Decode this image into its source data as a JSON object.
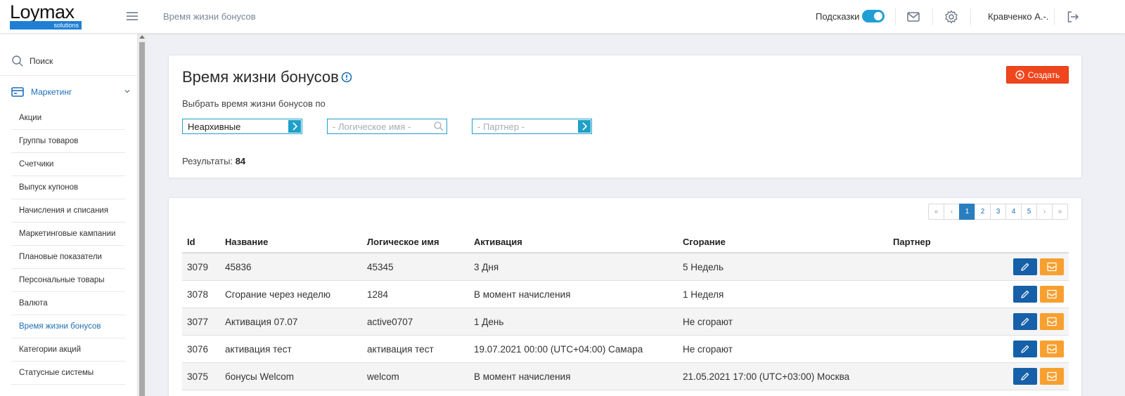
{
  "header": {
    "logo_text": "Loymax",
    "logo_sub": "solutions",
    "page_title": "Время жизни бонусов",
    "hints_label": "Подсказки",
    "user_name": "Кравченко А.-."
  },
  "sidebar": {
    "search_label": "Поиск",
    "section_label": "Маркетинг",
    "items": [
      {
        "label": "Акции"
      },
      {
        "label": "Группы товаров"
      },
      {
        "label": "Счетчики"
      },
      {
        "label": "Выпуск купонов"
      },
      {
        "label": "Начисления и списания"
      },
      {
        "label": "Маркетинговые кампании"
      },
      {
        "label": "Плановые показатели"
      },
      {
        "label": "Персональные товары"
      },
      {
        "label": "Валюта"
      },
      {
        "label": "Время жизни бонусов"
      },
      {
        "label": "Категории акций"
      },
      {
        "label": "Статусные системы"
      }
    ],
    "active_index": 9
  },
  "filter": {
    "title": "Время жизни бонусов",
    "create_label": "Создать",
    "caption": "Выбрать время жизни бонусов по",
    "archive_select_value": "Неархивные",
    "logical_name_placeholder": "- Логическое имя -",
    "partner_placeholder": "- Партнер -",
    "results_label": "Результаты:",
    "results_count": "84"
  },
  "pagination": {
    "first": "«",
    "prev": "‹",
    "pages": [
      "1",
      "2",
      "3",
      "4",
      "5"
    ],
    "current": "1",
    "next": "›",
    "last": "»"
  },
  "table": {
    "columns": {
      "id": "Id",
      "name": "Название",
      "logical_name": "Логическое имя",
      "activation": "Активация",
      "burn": "Сгорание",
      "partner": "Партнер"
    },
    "rows": [
      {
        "id": "3079",
        "name": "45836",
        "logical_name": "45345",
        "activation": "3 Дня",
        "burn": "5 Недель",
        "partner": ""
      },
      {
        "id": "3078",
        "name": "Сгорание через неделю",
        "logical_name": "1284",
        "activation": "В момент начисления",
        "burn": "1 Неделя",
        "partner": ""
      },
      {
        "id": "3077",
        "name": "Активация 07.07",
        "logical_name": "active0707",
        "activation": "1 День",
        "burn": "Не сгорают",
        "partner": ""
      },
      {
        "id": "3076",
        "name": "активация тест",
        "logical_name": "активация тест",
        "activation": "19.07.2021 00:00 (UTC+04:00) Самара",
        "burn": "Не сгорают",
        "partner": ""
      },
      {
        "id": "3075",
        "name": "бонусы Welcom",
        "logical_name": "welcom",
        "activation": "В момент начисления",
        "burn": "21.05.2021 17:00 (UTC+03:00) Москва",
        "partner": ""
      }
    ]
  },
  "colors": {
    "accent_blue": "#1f6fb5",
    "create_red": "#f0461d",
    "edit_blue": "#1560a8",
    "archive_orange": "#f7a030",
    "toggle_on": "#1f9fd4"
  },
  "icons": {
    "menu": "hamburger-icon",
    "mail": "mail-icon",
    "settings": "gear-icon",
    "logout": "logout-icon",
    "search": "search-icon",
    "marketing": "card-icon",
    "info": "info-icon",
    "edit": "pencil-icon",
    "archive": "archive-icon"
  }
}
